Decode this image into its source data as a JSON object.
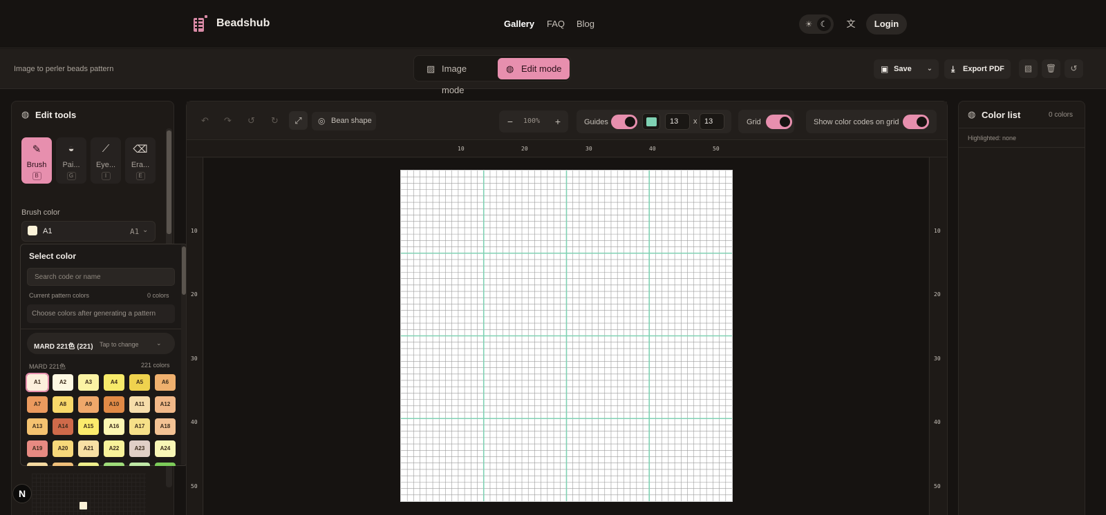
{
  "nav": {
    "brand": "Beadshub",
    "links": [
      "Gallery",
      "FAQ",
      "Blog"
    ],
    "active": "Gallery",
    "login": "Login"
  },
  "subbar": {
    "subtitle": "Image to perler beads pattern",
    "modes": [
      "Image mode",
      "Edit mode"
    ],
    "active_mode": "Edit mode",
    "save": "Save",
    "export": "Export PDF"
  },
  "edit_tools": {
    "title": "Edit tools",
    "tools": [
      {
        "label": "Brush",
        "key": "B"
      },
      {
        "label": "Pai...",
        "key": "G"
      },
      {
        "label": "Eye...",
        "key": "I"
      },
      {
        "label": "Era...",
        "key": "E"
      }
    ],
    "active_tool": "Brush",
    "brush_color_label": "Brush color",
    "brush_color_name": "A1",
    "brush_color_code": "A1"
  },
  "color_picker": {
    "title": "Select color",
    "search_placeholder": "Search code or name",
    "current_label": "Current pattern colors",
    "current_count": "0 colors",
    "current_empty": "Choose colors after generating a pattern",
    "palette_name": "MARD 221色 (221)",
    "palette_tap": "Tap to change",
    "palette_label": "MARD 221色",
    "palette_count": "221 colors",
    "swatches": [
      {
        "code": "A1",
        "color": "#fcefdc"
      },
      {
        "code": "A2",
        "color": "#fdf8e2"
      },
      {
        "code": "A3",
        "color": "#fbf3a4"
      },
      {
        "code": "A4",
        "color": "#f7ea6a"
      },
      {
        "code": "A5",
        "color": "#efd24e"
      },
      {
        "code": "A6",
        "color": "#efb06e"
      },
      {
        "code": "A7",
        "color": "#eb9a5e"
      },
      {
        "code": "A8",
        "color": "#f8d86a"
      },
      {
        "code": "A9",
        "color": "#efa86a"
      },
      {
        "code": "A10",
        "color": "#e18a46"
      },
      {
        "code": "A11",
        "color": "#f6ddaa"
      },
      {
        "code": "A12",
        "color": "#f1b888"
      },
      {
        "code": "A13",
        "color": "#f4c270"
      },
      {
        "code": "A14",
        "color": "#cf6a4a"
      },
      {
        "code": "A15",
        "color": "#fbeb6c"
      },
      {
        "code": "A16",
        "color": "#fcf6b2"
      },
      {
        "code": "A17",
        "color": "#f6e088"
      },
      {
        "code": "A18",
        "color": "#f3c294"
      },
      {
        "code": "A19",
        "color": "#e78a82"
      },
      {
        "code": "A20",
        "color": "#f7d87a"
      },
      {
        "code": "A21",
        "color": "#f8e0a4"
      },
      {
        "code": "A22",
        "color": "#f8f29a"
      },
      {
        "code": "A23",
        "color": "#e0cfc6"
      },
      {
        "code": "A24",
        "color": "#f8f6b6"
      }
    ],
    "partial_row_colors": [
      "#f5d9a0",
      "#f0c07a",
      "#eeee8a",
      "#9fdc7a",
      "#bfe8a6",
      "#7ccc5a"
    ]
  },
  "canvas": {
    "bean_shape": "Bean shape",
    "zoom": "100%",
    "guides_label": "Guides",
    "guide_color": "#7fd1b3",
    "guide_w": "13",
    "guide_h": "13",
    "dim_sep": "x",
    "grid_label": "Grid",
    "codes_label": "Show color codes on grid",
    "ruler_ticks": [
      "10",
      "20",
      "30",
      "40",
      "50"
    ],
    "grid_cells": 52,
    "guide_every": 13,
    "guides_on": true,
    "grid_on": true,
    "codes_on": true
  },
  "color_list": {
    "title": "Color list",
    "count": "0 colors",
    "highlighted": "Highlighted: none"
  },
  "badge": "N"
}
